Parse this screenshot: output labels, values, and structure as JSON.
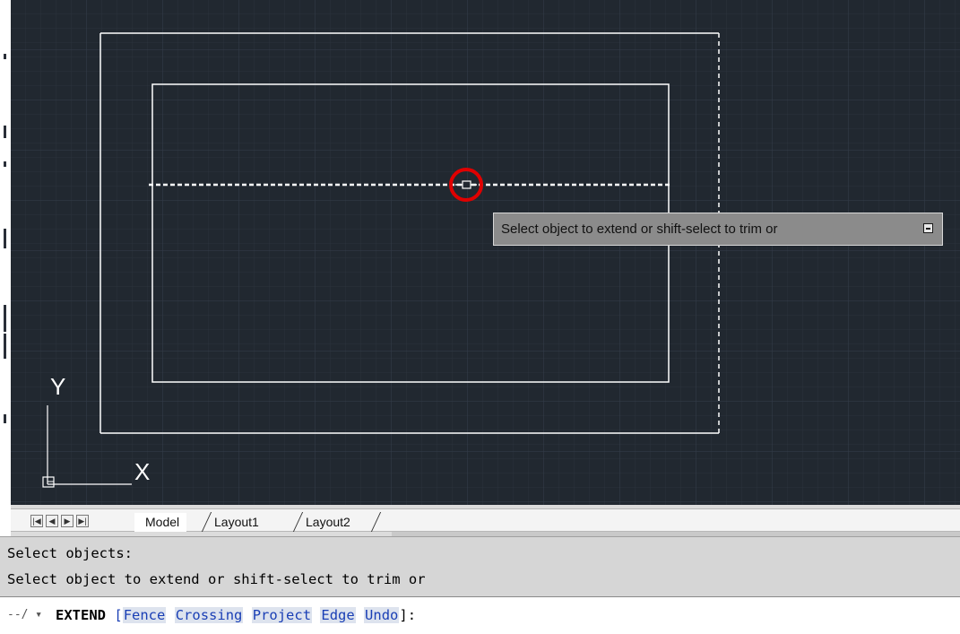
{
  "tooltip": {
    "text": "Select object to extend or shift-select to trim or",
    "icon": "options-down-icon"
  },
  "ucs": {
    "x_label": "X",
    "y_label": "Y"
  },
  "tabs": {
    "nav": [
      "|◀",
      "◀",
      "▶",
      "▶|"
    ],
    "model": "Model",
    "layout1": "Layout1",
    "layout2": "Layout2"
  },
  "command": {
    "history": [
      "Select objects:",
      "Select object to extend or shift-select to trim or"
    ],
    "icon": "command-wrench-icon",
    "icon_text": "--/ ▾",
    "name": "EXTEND",
    "open_bracket": "[",
    "options": [
      "Fence",
      "Crossing",
      "Project",
      "Edge",
      "Undo"
    ],
    "close_bracket": "]:"
  },
  "colors": {
    "canvas": "#212830",
    "selection_marker": "#e00000",
    "geometry": "#ffffff"
  }
}
